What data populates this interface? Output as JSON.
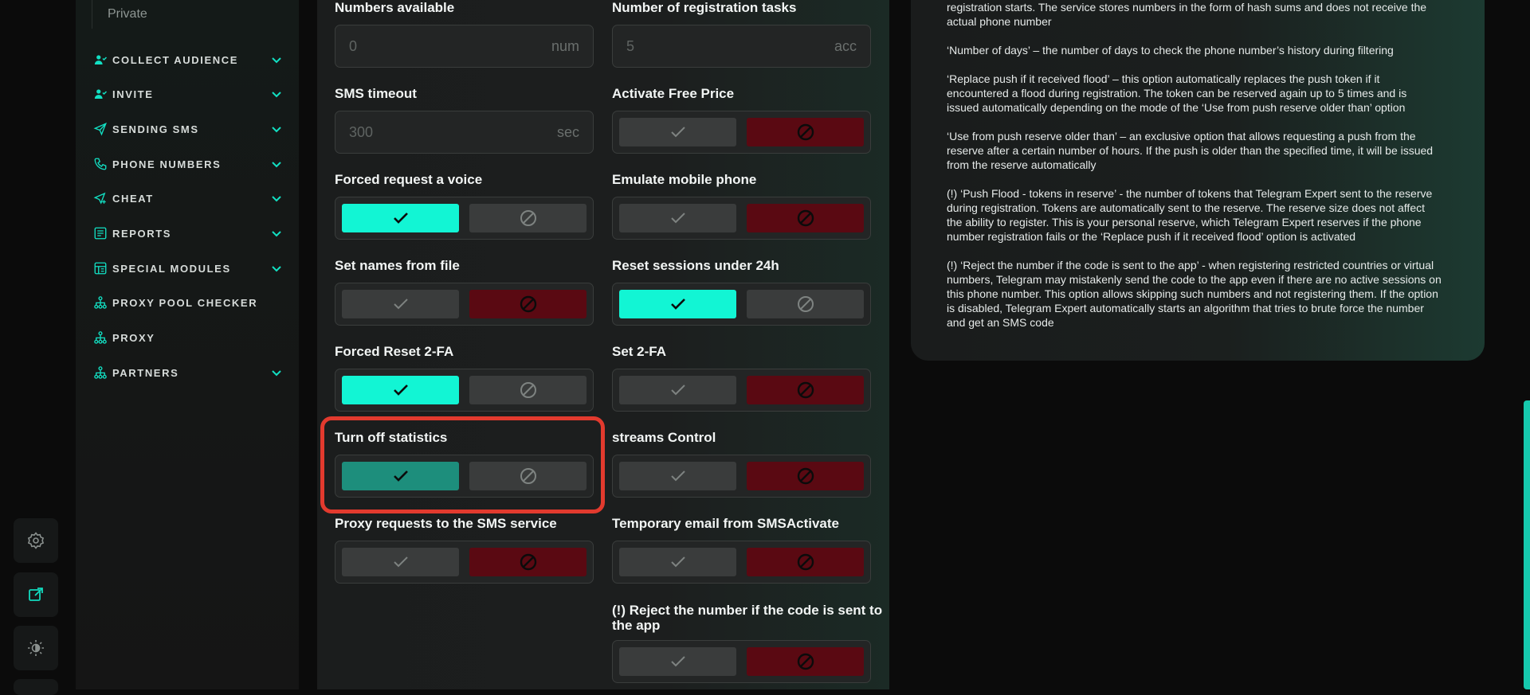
{
  "sidebar": {
    "private_label": "Private",
    "items": [
      {
        "label": "COLLECT AUDIENCE",
        "icon": "users-icon",
        "chevron": true
      },
      {
        "label": "INVITE",
        "icon": "users-icon",
        "chevron": true
      },
      {
        "label": "SENDING SMS",
        "icon": "send-icon",
        "chevron": true
      },
      {
        "label": "PHONE NUMBERS",
        "icon": "phone-icon",
        "chevron": true
      },
      {
        "label": "CHEAT",
        "icon": "send-plus-icon",
        "chevron": true
      },
      {
        "label": "REPORTS",
        "icon": "report-icon",
        "chevron": true
      },
      {
        "label": "SPECIAL MODULES",
        "icon": "modules-icon",
        "chevron": true
      },
      {
        "label": "PROXY POOL CHECKER",
        "icon": "network-icon",
        "chevron": false
      },
      {
        "label": "PROXY",
        "icon": "network-icon",
        "chevron": false
      },
      {
        "label": "PARTNERS",
        "icon": "network-icon",
        "chevron": true
      }
    ]
  },
  "rail": {
    "buttons": [
      "settings-icon",
      "external-link-icon",
      "theme-icon"
    ]
  },
  "form": {
    "numbers_available": {
      "label": "Numbers available",
      "value": "0",
      "unit": "num"
    },
    "registration_tasks": {
      "label": "Number of registration tasks",
      "value": "5",
      "unit": "acc"
    },
    "sms_timeout": {
      "label": "SMS timeout",
      "value": "300",
      "unit": "sec"
    },
    "activate_free_price": {
      "label": "Activate Free Price",
      "state": "off"
    },
    "forced_voice": {
      "label": "Forced request a voice",
      "state": "on"
    },
    "emulate_mobile": {
      "label": "Emulate mobile phone",
      "state": "off"
    },
    "set_names": {
      "label": "Set names from file",
      "state": "off"
    },
    "reset_sessions": {
      "label": "Reset sessions under 24h",
      "state": "on"
    },
    "forced_reset_2fa": {
      "label": "Forced Reset 2-FA",
      "state": "on"
    },
    "set_2fa": {
      "label": "Set 2-FA",
      "state": "off"
    },
    "turn_off_statistics": {
      "label": "Turn off statistics",
      "state": "on"
    },
    "streams_control": {
      "label": "streams Control",
      "state": "off"
    },
    "proxy_requests": {
      "label": "Proxy requests to the SMS service",
      "state": "off"
    },
    "temp_email": {
      "label": "Temporary email from SMSActivate",
      "state": "off"
    },
    "reject_number": {
      "label_line1": "(!) Reject the number if the code is sent to",
      "label_line2": "the app",
      "state": "off"
    }
  },
  "info": {
    "paragraphs": [
      [
        "registration starts. The service stores numbers in the form of hash sums and does not receive the",
        "actual phone number"
      ],
      [
        "‘Number of days’ – the number of days to check the phone number’s history during filtering"
      ],
      [
        "‘Replace push if it received flood’ – this option automatically replaces the push token if it",
        "encountered a flood during registration. The token can be reserved again up to 5 times and is",
        "issued automatically depending on the mode of the ‘Use from push reserve older than’ option"
      ],
      [
        "‘Use from push reserve older than’ – an exclusive option that allows requesting a push from the",
        "reserve after a certain number of hours. If the push is older than the specified time, it will be issued",
        "from the reserve automatically"
      ],
      [
        "(!) ‘Push Flood - tokens in reserve’ - the number of tokens that Telegram Expert sent to the reserve",
        "during registration. Tokens are automatically sent to the reserve. The reserve size does not affect",
        "the ability to register. This is your personal reserve, which Telegram Expert reserves if the phone",
        "number registration fails or the ‘Replace push if it received flood’ option is activated"
      ],
      [
        "(!) ‘Reject the number if the code is sent to the app’ - when registering restricted countries or virtual",
        "numbers, Telegram may mistakenly send the code to the app even if there are no active sessions on",
        "this phone number. This option allows skipping such numbers and not registering them. If the option",
        "is disabled, Telegram Expert automatically starts an algorithm that tries to brute force the number",
        "and get an SMS code"
      ]
    ]
  },
  "colors": {
    "accent": "#12f5d4",
    "accent_dim": "#1d8e7c",
    "deny": "#5a0912",
    "highlight": "#e23a2e"
  }
}
